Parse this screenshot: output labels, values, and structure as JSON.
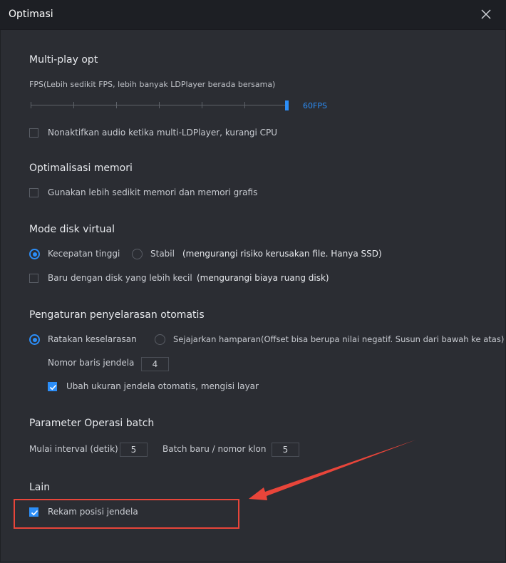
{
  "window": {
    "title": "Optimasi"
  },
  "multiplay": {
    "heading": "Multi-play opt",
    "fps_label": "FPS(Lebih sedikit FPS, lebih banyak LDPlayer berada bersama)",
    "fps_value": "60FPS",
    "audio_label": "Nonaktifkan audio ketika multi-LDPlayer, kurangi CPU",
    "audio_checked": false
  },
  "memory": {
    "heading": "Optimalisasi memori",
    "less_memory_label": "Gunakan lebih sedikit memori dan memori grafis",
    "less_memory_checked": false
  },
  "disk": {
    "heading": "Mode disk virtual",
    "speed_label": "Kecepatan tinggi",
    "stable_label": "Stabil",
    "stable_note": "(mengurangi risiko kerusakan file. Hanya SSD)",
    "selected": "Kecepatan tinggi",
    "small_disk_label": "Baru dengan disk yang lebih kecil",
    "small_disk_note": "(mengurangi biaya ruang disk)",
    "small_disk_checked": false
  },
  "arrange": {
    "heading": "Pengaturan penyelarasan otomatis",
    "flatten_label": "Ratakan keselarasan",
    "tile_label": "Sejajarkan hamparan(Offset bisa berupa nilai negatif. Susun dari bawah ke atas)",
    "selected": "Ratakan keselarasan",
    "rows_label": "Nomor baris jendela",
    "rows_value": "4",
    "autosize_label": "Ubah ukuran jendela otomatis, mengisi layar",
    "autosize_checked": true
  },
  "batch": {
    "heading": "Parameter Operasi batch",
    "interval_label": "Mulai interval (detik)",
    "interval_value": "5",
    "clone_label": "Batch baru / nomor klon",
    "clone_value": "5"
  },
  "other": {
    "heading": "Lain",
    "record_label": "Rekam posisi jendela",
    "record_checked": true
  },
  "colors": {
    "accent": "#2c8ef8",
    "annotation": "#e8453a",
    "background": "#2b2d33",
    "titlebar": "#1d1f24"
  },
  "icons": {
    "close": "close-icon",
    "check": "check-icon",
    "arrow": "annotation-arrow"
  }
}
